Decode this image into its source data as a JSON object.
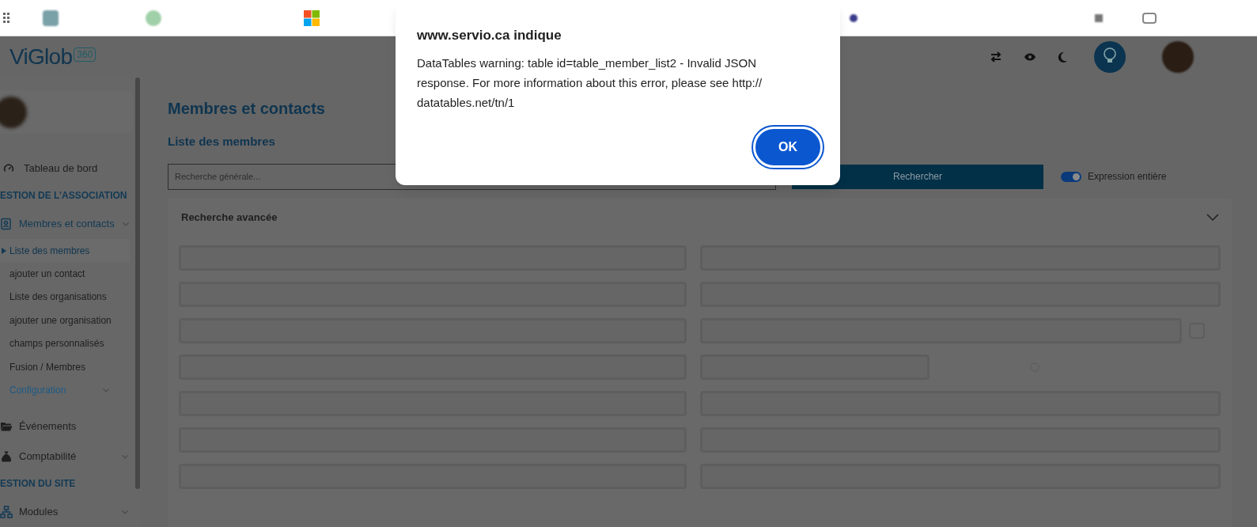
{
  "header": {
    "logo_text": "ViGlob",
    "logo_badge": "360"
  },
  "sidebar": {
    "items": [
      {
        "kind": "link",
        "label": "Tableau de bord",
        "expanded": false,
        "expandable": false
      },
      {
        "kind": "section",
        "label": "ESTION DE L’ASSOCIATION"
      },
      {
        "kind": "link",
        "label": "Membres et contacts",
        "expanded": true,
        "expandable": true,
        "children": [
          {
            "label": "Liste des membres",
            "selected": true,
            "expandable": false
          },
          {
            "label": "ajouter un contact",
            "selected": false,
            "expandable": false
          },
          {
            "label": "Liste des organisations",
            "selected": false,
            "expandable": false
          },
          {
            "label": "ajouter une organisation",
            "selected": false,
            "expandable": false
          },
          {
            "label": "champs personnalisés",
            "selected": false,
            "expandable": false
          },
          {
            "label": "Fusion / Membres",
            "selected": false,
            "expandable": false
          },
          {
            "label": "Configuration",
            "selected": false,
            "expandable": true
          }
        ]
      },
      {
        "kind": "link",
        "label": "Événements",
        "expanded": false,
        "expandable": false
      },
      {
        "kind": "link",
        "label": "Comptabilité",
        "expanded": false,
        "expandable": true
      },
      {
        "kind": "section",
        "label": "ESTION DU SITE"
      },
      {
        "kind": "link",
        "label": "Modules",
        "expanded": false,
        "expandable": true
      }
    ]
  },
  "main": {
    "title": "Membres et contacts",
    "subtitle": "Liste des membres",
    "search": {
      "placeholder": "Recherche générale...",
      "button": "Rechercher",
      "toggle_label": "Expression entière",
      "toggle_on": true
    },
    "advanced": {
      "title": "Recherche avancée",
      "expanded": true,
      "rows": [
        {
          "kind": "pair"
        },
        {
          "kind": "pair"
        },
        {
          "kind": "button"
        },
        {
          "kind": "short"
        },
        {
          "kind": "pair"
        },
        {
          "kind": "pair"
        },
        {
          "kind": "pair"
        }
      ]
    }
  },
  "dialog": {
    "title": "www.servio.ca indique",
    "message": "DataTables warning: table id=table_member_list2 - Invalid JSON response. For more information about this error, please see http:// datatables.net/tn/1",
    "button": "OK"
  }
}
